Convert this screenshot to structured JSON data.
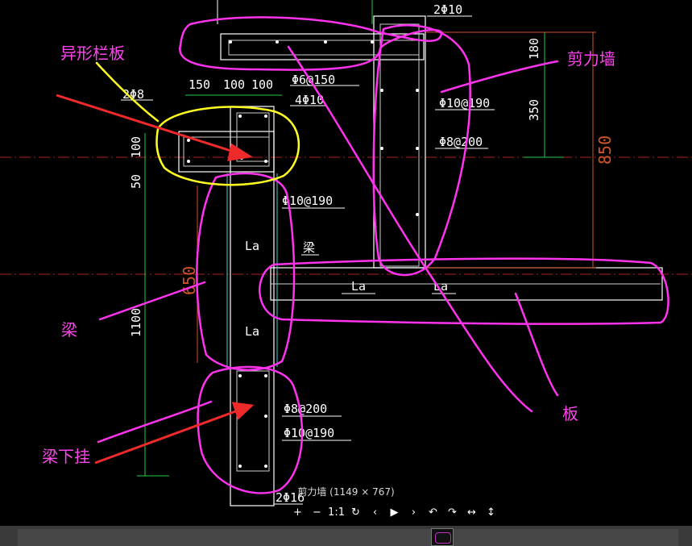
{
  "drawing": {
    "annotations": {
      "irregular_parapet": "异形栏板",
      "shear_wall": "剪力墙",
      "beam": "梁",
      "slab": "板",
      "beam_hanging": "梁下挂"
    },
    "dimensions": {
      "d150": "150",
      "d100a": "100",
      "d100b": "100",
      "v100": "100",
      "v50": "50",
      "v1100": "1100",
      "v180": "180",
      "v350": "350",
      "v850": "850",
      "v650": "650"
    },
    "rebar": {
      "top_2phi10": "2Φ10",
      "parapet_2phi8": "2Φ8",
      "phi6_150": "Φ6@150",
      "r4phi10": "4Φ10",
      "wall_phi10_190": "Φ10@190",
      "wall_phi8_200": "Φ8@200",
      "beam_phi10_190": "Φ10@190",
      "low_phi8_200": "Φ8@200",
      "low_phi10_190": "Φ10@190",
      "bottom_2phi16": "2Φ16"
    },
    "labels": {
      "la1": "La",
      "la2": "La",
      "la3": "La",
      "la4": "La",
      "beam_small": "梁"
    },
    "colors": {
      "background": "#000000",
      "annotation_magenta": "#ff33ee",
      "highlight_yellow": "#ffff22",
      "arrow_red": "#ee2a2a",
      "dimension_red": "#d0552a",
      "dimension_green": "#22cc44",
      "structure_white": "#ffffff"
    }
  },
  "viewer": {
    "caption": "剪力墙 (1149 × 767)",
    "toolbar": [
      {
        "name": "zoom-in-button",
        "icon": "plus-icon",
        "glyph": "+"
      },
      {
        "name": "zoom-out-button",
        "icon": "minus-icon",
        "glyph": "−"
      },
      {
        "name": "actual-size-button",
        "icon": "one-to-one-icon",
        "glyph": "1:1"
      },
      {
        "name": "refresh-button",
        "icon": "refresh-icon",
        "glyph": "↻"
      },
      {
        "name": "previous-button",
        "icon": "chevron-left-icon",
        "glyph": "‹"
      },
      {
        "name": "play-button",
        "icon": "play-icon",
        "glyph": "▶"
      },
      {
        "name": "next-button",
        "icon": "chevron-right-icon",
        "glyph": "›"
      },
      {
        "name": "rotate-left-button",
        "icon": "rotate-left-icon",
        "glyph": "↶"
      },
      {
        "name": "rotate-right-button",
        "icon": "rotate-right-icon",
        "glyph": "↷"
      },
      {
        "name": "flip-horizontal-button",
        "icon": "flip-horizontal-icon",
        "glyph": "↔"
      },
      {
        "name": "flip-vertical-button",
        "icon": "flip-vertical-icon",
        "glyph": "↕"
      }
    ]
  }
}
